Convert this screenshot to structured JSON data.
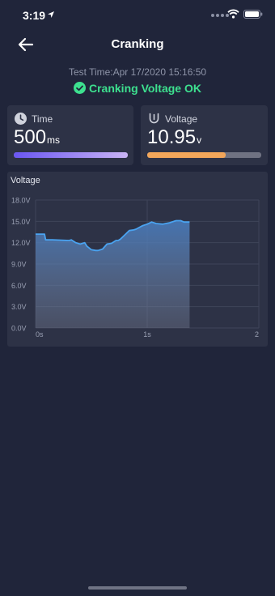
{
  "status_bar": {
    "time": "3:19"
  },
  "nav": {
    "title": "Cranking",
    "back": "back"
  },
  "test_time": "Test Time:Apr 17/2020 15:16:50",
  "result": "Cranking Voltage OK",
  "cards": {
    "time": {
      "label": "Time",
      "value": "500",
      "unit": "ms",
      "progress": 1.0
    },
    "voltage": {
      "label": "Voltage",
      "value": "10.95",
      "unit": "v",
      "progress": 0.69
    }
  },
  "colors": {
    "background": "#20253a",
    "card": "#2d3246",
    "ok_green": "#3de08f",
    "line_blue": "#4aa3f0",
    "voltage_bar": "#f2a65a",
    "time_bar_start": "#6a56f2",
    "time_bar_end": "#c9b4f4"
  },
  "chart_data": {
    "type": "area",
    "title": "Voltage",
    "xlabel": "",
    "ylabel": "",
    "ylim": [
      0,
      18
    ],
    "xlim": [
      0,
      2
    ],
    "y_ticks": [
      "0.0V",
      "3.0V",
      "6.0V",
      "9.0V",
      "12.0V",
      "15.0V",
      "18.0V"
    ],
    "x_ticks": [
      "0s",
      "1s",
      "2"
    ],
    "grid": true,
    "series": [
      {
        "x": [
          0,
          0.08,
          0.09,
          0.15,
          0.3,
          0.32,
          0.36,
          0.4,
          0.44,
          0.46,
          0.5,
          0.54,
          0.56,
          0.6,
          0.64,
          0.68,
          0.72,
          0.74,
          0.76,
          0.8,
          0.84,
          0.88,
          0.9,
          0.96,
          1.0,
          1.04,
          1.08,
          1.14,
          1.2,
          1.24,
          1.26,
          1.3,
          1.33,
          1.36,
          1.38
        ],
        "y": [
          13.2,
          13.2,
          12.4,
          12.4,
          12.3,
          12.4,
          12.0,
          11.8,
          12.0,
          11.5,
          11.0,
          10.9,
          10.9,
          11.1,
          11.8,
          11.9,
          12.3,
          12.3,
          12.5,
          13.1,
          13.7,
          13.8,
          13.9,
          14.4,
          14.6,
          14.9,
          14.7,
          14.6,
          14.8,
          15.0,
          15.1,
          15.1,
          14.9,
          14.9,
          14.9
        ]
      }
    ]
  }
}
